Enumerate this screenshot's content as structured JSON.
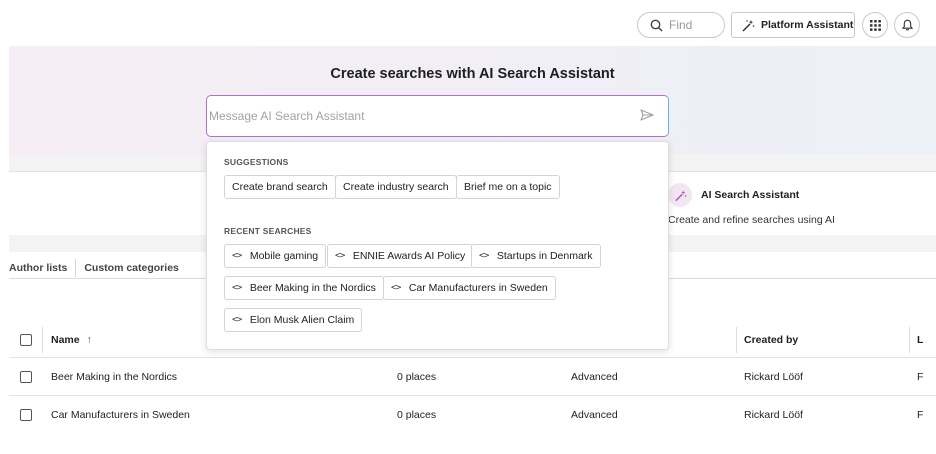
{
  "topbar": {
    "find_placeholder": "Find",
    "platform_assistant_label": "Platform Assistant",
    "icons": [
      "search-icon",
      "magic-wand-icon",
      "apps-grid-icon",
      "bell-icon"
    ]
  },
  "hero": {
    "title": "Create searches with AI Search Assistant",
    "message_placeholder": "Message AI Search Assistant"
  },
  "dropdown": {
    "suggestions_label": "SUGGESTIONS",
    "suggestions": [
      "Create brand search",
      "Create industry search",
      "Brief me on a topic"
    ],
    "recent_label": "RECENT SEARCHES",
    "recent": [
      "Mobile gaming",
      "ENNIE Awards AI Policy",
      "Startups in Denmark",
      "Beer Making in the Nordics",
      "Car Manufacturers in Sweden",
      "Elon Musk Alien Claim"
    ]
  },
  "ai_card": {
    "title": "AI Search Assistant",
    "subtitle": "Create and refine searches using AI"
  },
  "tabs": {
    "author_lists": "Author lists",
    "custom_categories": "Custom categories"
  },
  "table": {
    "headers": {
      "name": "Name",
      "sort_arrow": "↑",
      "created_by": "Created by",
      "last": "L"
    },
    "rows": [
      {
        "name": "Beer Making in the Nordics",
        "places": "0 places",
        "type": "Advanced",
        "created_by": "Rickard Lööf",
        "last": "F"
      },
      {
        "name": "Car Manufacturers in Sweden",
        "places": "0 places",
        "type": "Advanced",
        "created_by": "Rickard Lööf",
        "last": "F"
      }
    ]
  },
  "colors": {
    "accent_purple": "#b36fc9",
    "accent_blue": "#6fb0d9",
    "hero_bg": "#f1eef6"
  }
}
